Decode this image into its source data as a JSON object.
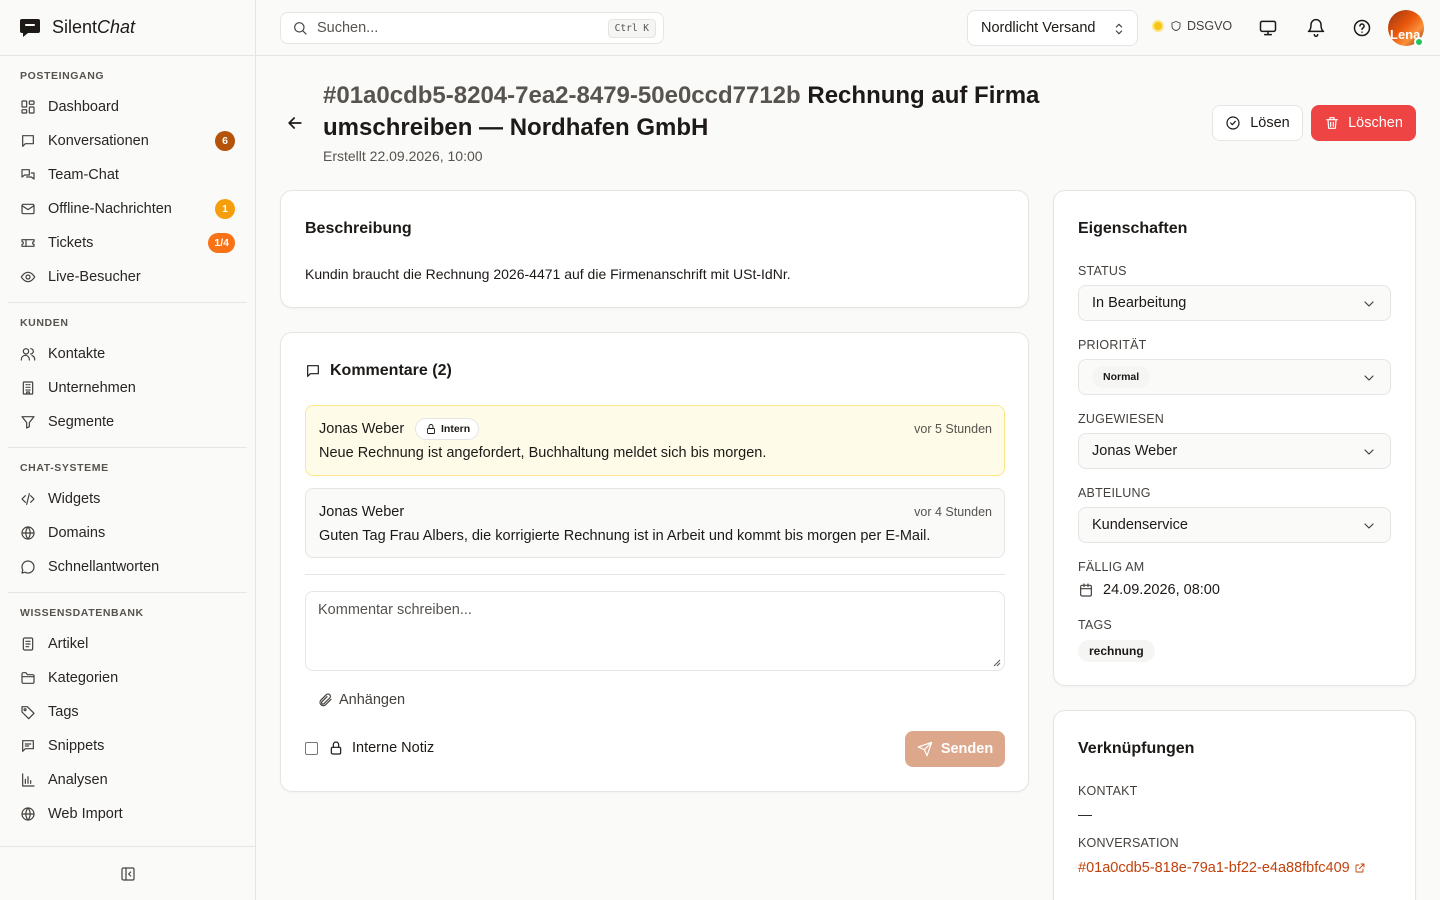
{
  "app": {
    "name_plain": "Silent",
    "name_italic": "Chat"
  },
  "sidebar": {
    "groups": [
      {
        "title": "POSTEINGANG",
        "items": [
          {
            "label": "Dashboard",
            "icon": "dashboard-icon"
          },
          {
            "label": "Konversationen",
            "icon": "chat-icon",
            "badge": "6",
            "badge_color": "#b45309"
          },
          {
            "label": "Team-Chat",
            "icon": "team-chat-icon"
          },
          {
            "label": "Offline-Nachrichten",
            "icon": "mail-icon",
            "badge": "1",
            "badge_color": "#f59e0b"
          },
          {
            "label": "Tickets",
            "icon": "ticket-icon",
            "badge": "1/4",
            "badge_color": "#f97316"
          },
          {
            "label": "Live-Besucher",
            "icon": "eye-icon"
          }
        ]
      },
      {
        "title": "KUNDEN",
        "items": [
          {
            "label": "Kontakte",
            "icon": "users-icon"
          },
          {
            "label": "Unternehmen",
            "icon": "building-icon"
          },
          {
            "label": "Segmente",
            "icon": "filter-icon"
          }
        ]
      },
      {
        "title": "CHAT-SYSTEME",
        "items": [
          {
            "label": "Widgets",
            "icon": "code-icon"
          },
          {
            "label": "Domains",
            "icon": "globe-icon"
          },
          {
            "label": "Schnellantworten",
            "icon": "message-circle-icon"
          }
        ]
      },
      {
        "title": "WISSENSDATENBANK",
        "items": [
          {
            "label": "Artikel",
            "icon": "article-icon"
          },
          {
            "label": "Kategorien",
            "icon": "folder-icon"
          },
          {
            "label": "Tags",
            "icon": "tag-icon"
          },
          {
            "label": "Snippets",
            "icon": "snippet-icon"
          },
          {
            "label": "Analysen",
            "icon": "bar-chart-icon"
          },
          {
            "label": "Web Import",
            "icon": "globe-icon"
          }
        ]
      }
    ]
  },
  "topbar": {
    "search_placeholder": "Suchen...",
    "search_shortcut": "Ctrl K",
    "org": "Nordlicht Versand",
    "dsgvo": "DSGVO",
    "avatar_initials": "Lena"
  },
  "ticket": {
    "id": "#01a0cdb5-8204-7ea2-8479-50e0ccd7712b",
    "title": "Rechnung auf Firma umschreiben — Nordhafen GmbH",
    "created": "Erstellt 22.09.2026, 10:00",
    "resolve_label": "Lösen",
    "delete_label": "Löschen",
    "description_title": "Beschreibung",
    "description": "Kundin braucht die Rechnung 2026-4471 auf die Firmenanschrift mit USt-IdNr."
  },
  "comments": {
    "title": "Kommentare (2)",
    "items": [
      {
        "author": "Jonas Weber",
        "badge": "Intern",
        "time": "vor 5 Stunden",
        "text": "Neue Rechnung ist angefordert, Buchhaltung meldet sich bis morgen."
      },
      {
        "author": "Jonas Weber",
        "time": "vor 4 Stunden",
        "text": "Guten Tag Frau Albers, die korrigierte Rechnung ist in Arbeit und kommt bis morgen per E-Mail."
      }
    ],
    "placeholder": "Kommentar schreiben...",
    "attach_label": "Anhängen",
    "internal_note_label": "Interne Notiz",
    "send_label": "Senden"
  },
  "properties": {
    "title": "Eigenschaften",
    "status_label": "STATUS",
    "status": "In Bearbeitung",
    "priority_label": "PRIORITÄT",
    "priority": "Normal",
    "assigned_label": "ZUGEWIESEN",
    "assigned": "Jonas Weber",
    "department_label": "ABTEILUNG",
    "department": "Kundenservice",
    "due_label": "FÄLLIG AM",
    "due": "24.09.2026, 08:00",
    "tags_label": "TAGS",
    "tag": "rechnung"
  },
  "links": {
    "title": "Verknüpfungen",
    "contact_label": "KONTAKT",
    "contact": "—",
    "conversation_label": "KONVERSATION",
    "conversation": "#01a0cdb5-818e-79a1-bf22-e4a88fbfc409"
  },
  "colors": {
    "accent": "#c2410c",
    "danger": "#ef4444",
    "send_disabled": "#dca78b",
    "internal_bg": "#fefce8"
  }
}
